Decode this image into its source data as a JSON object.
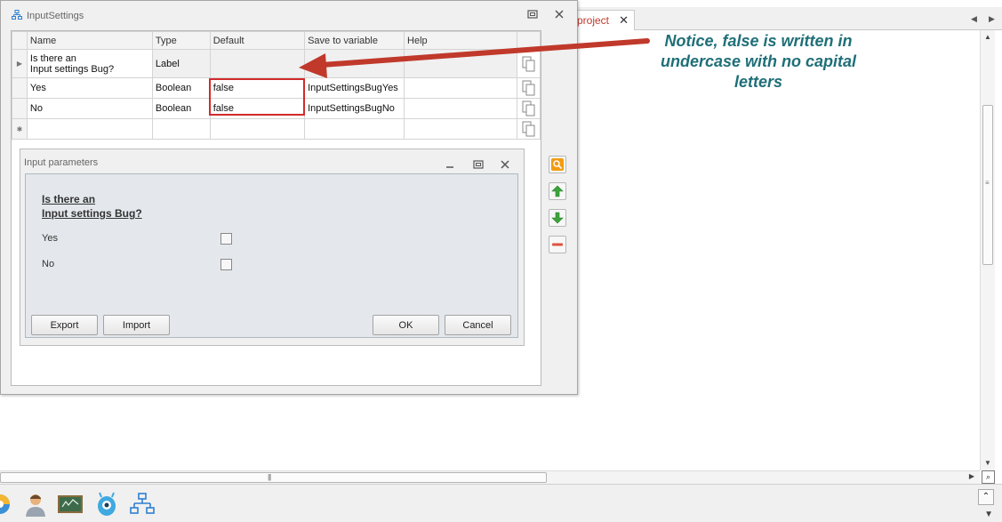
{
  "background": {
    "tab_label": "project",
    "tab_close": "✕",
    "tab_prev": "◀",
    "tab_next": "▶"
  },
  "window": {
    "title": "InputSettings"
  },
  "grid": {
    "columns": [
      "Name",
      "Type",
      "Default",
      "Save to variable",
      "Help"
    ],
    "rows": [
      {
        "name": "Is there an\nInput settings Bug?",
        "type": "Label",
        "default": "",
        "variable": "",
        "help": ""
      },
      {
        "name": "Yes",
        "type": "Boolean",
        "default": "false",
        "variable": "InputSettingsBugYes",
        "help": ""
      },
      {
        "name": "No",
        "type": "Boolean",
        "default": "false",
        "variable": "InputSettingsBugNo",
        "help": ""
      }
    ],
    "current_row_marker": "▶",
    "new_row_marker": "✱"
  },
  "input_parameters": {
    "title": "Input parameters",
    "heading_line1": "Is there an",
    "heading_line2": "Input settings Bug?",
    "yes_label": "Yes",
    "no_label": "No",
    "export_label": "Export",
    "import_label": "Import",
    "ok_label": "OK",
    "cancel_label": "Cancel"
  },
  "annotation": {
    "line1": "Notice, false is written in",
    "line2": "undercase with no capital",
    "line3": "letters",
    "color": "#1f6f78",
    "arrow_color": "#c0392b"
  },
  "colors": {
    "highlight_box": "#d22a2a",
    "search_button": "#f39c12",
    "up_arrow": "#3aa53a",
    "down_arrow": "#3aa53a",
    "remove_button": "#e05040"
  }
}
